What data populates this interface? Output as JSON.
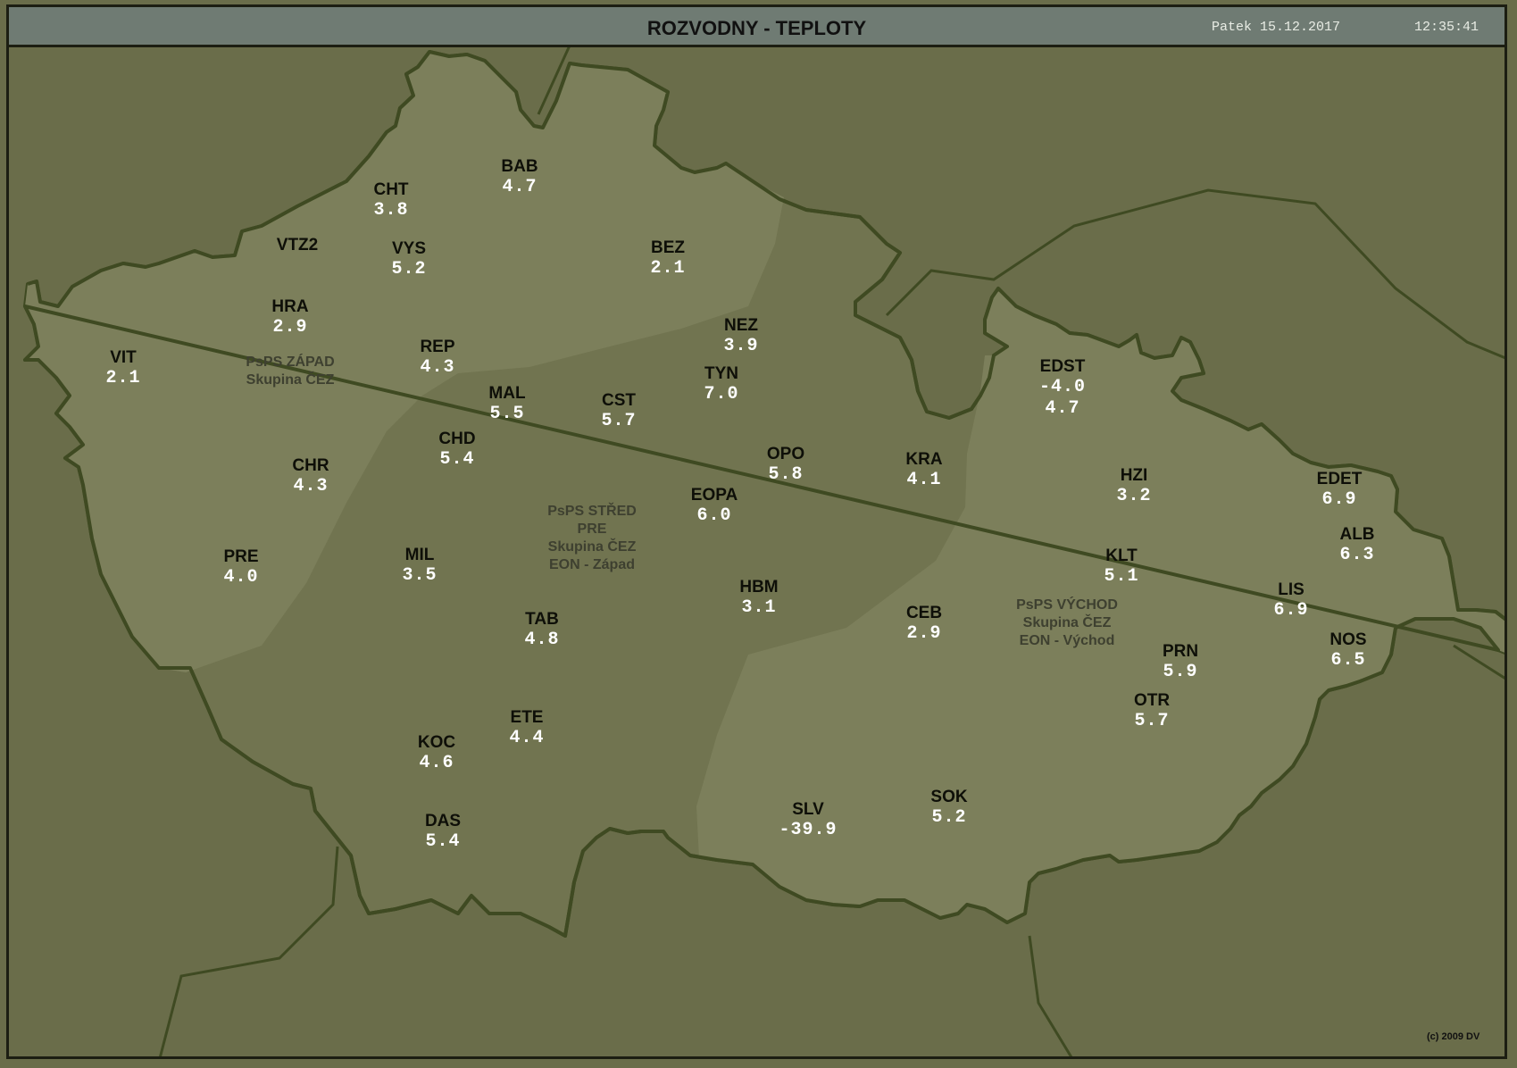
{
  "header": {
    "title": "ROZVODNY - TEPLOTY",
    "date": "Patek 15.12.2017",
    "time": "12:35:41"
  },
  "colors": {
    "background": "#6a6d4a",
    "region_light": "#7c7f5b",
    "region_mid": "#717450",
    "border": "#3f4a22",
    "header": "#6f7b73"
  },
  "regions": [
    {
      "lines": [
        "PsPS ZÁPAD",
        "Skupina ČEZ"
      ]
    },
    {
      "lines": [
        "PsPS STŘED",
        "PRE",
        "Skupina ČEZ",
        "EON - Západ"
      ]
    },
    {
      "lines": [
        "PsPS VÝCHOD",
        "Skupina ČEZ",
        "EON - Východ"
      ]
    }
  ],
  "stations": [
    {
      "name": "BAB",
      "values": [
        "4.7"
      ]
    },
    {
      "name": "CHT",
      "values": [
        "3.8"
      ]
    },
    {
      "name": "VTZ2",
      "values": []
    },
    {
      "name": "VYS",
      "values": [
        "5.2"
      ]
    },
    {
      "name": "BEZ",
      "values": [
        "2.1"
      ]
    },
    {
      "name": "HRA",
      "values": [
        "2.9"
      ]
    },
    {
      "name": "VIT",
      "values": [
        "2.1"
      ]
    },
    {
      "name": "REP",
      "values": [
        "4.3"
      ]
    },
    {
      "name": "NEZ",
      "values": [
        "3.9"
      ]
    },
    {
      "name": "TYN",
      "values": [
        "7.0"
      ]
    },
    {
      "name": "MAL",
      "values": [
        "5.5"
      ]
    },
    {
      "name": "CST",
      "values": [
        "5.7"
      ]
    },
    {
      "name": "CHD",
      "values": [
        "5.4"
      ]
    },
    {
      "name": "EDST",
      "values": [
        "-4.0",
        "4.7"
      ]
    },
    {
      "name": "OPO",
      "values": [
        "5.8"
      ]
    },
    {
      "name": "KRA",
      "values": [
        "4.1"
      ]
    },
    {
      "name": "CHR",
      "values": [
        "4.3"
      ]
    },
    {
      "name": "HZI",
      "values": [
        "3.2"
      ]
    },
    {
      "name": "EDET",
      "values": [
        "6.9"
      ]
    },
    {
      "name": "EOPA",
      "values": [
        "6.0"
      ]
    },
    {
      "name": "ALB",
      "values": [
        "6.3"
      ]
    },
    {
      "name": "PRE",
      "values": [
        "4.0"
      ]
    },
    {
      "name": "MIL",
      "values": [
        "3.5"
      ]
    },
    {
      "name": "KLT",
      "values": [
        "5.1"
      ]
    },
    {
      "name": "HBM",
      "values": [
        "3.1"
      ]
    },
    {
      "name": "LIS",
      "values": [
        "6.9"
      ]
    },
    {
      "name": "TAB",
      "values": [
        "4.8"
      ]
    },
    {
      "name": "CEB",
      "values": [
        "2.9"
      ]
    },
    {
      "name": "NOS",
      "values": [
        "6.5"
      ]
    },
    {
      "name": "PRN",
      "values": [
        "5.9"
      ]
    },
    {
      "name": "OTR",
      "values": [
        "5.7"
      ]
    },
    {
      "name": "ETE",
      "values": [
        "4.4"
      ]
    },
    {
      "name": "KOC",
      "values": [
        "4.6"
      ]
    },
    {
      "name": "SLV",
      "values": [
        "-39.9"
      ]
    },
    {
      "name": "SOK",
      "values": [
        "5.2"
      ]
    },
    {
      "name": "DAS",
      "values": [
        "5.4"
      ]
    }
  ],
  "footer": {
    "copyright": "(c) 2009 DV"
  }
}
